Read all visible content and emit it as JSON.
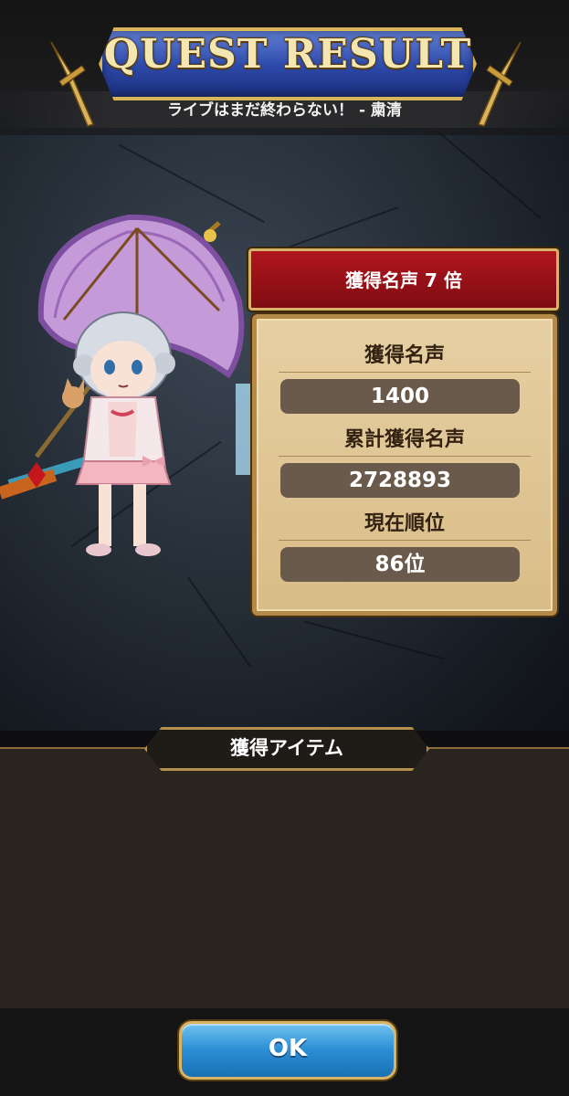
{
  "header": {
    "title": "QUEST RESULT",
    "subtitle": "ライブはまだ終わらない！ - 粛清"
  },
  "fame_banner": {
    "label": "獲得名声 7 倍"
  },
  "stats": [
    {
      "label": "獲得名声",
      "value": "1400"
    },
    {
      "label": "累計獲得名声",
      "value": "2728893"
    },
    {
      "label": "現在順位",
      "value": "86位"
    }
  ],
  "items": {
    "header": "獲得アイテム"
  },
  "ok_button": {
    "label": "OK"
  },
  "colors": {
    "banner_red": "#b1161d",
    "panel_tan": "#e6cfa2",
    "button_blue": "#2a8ed4",
    "gold_border": "#d6b26a"
  }
}
